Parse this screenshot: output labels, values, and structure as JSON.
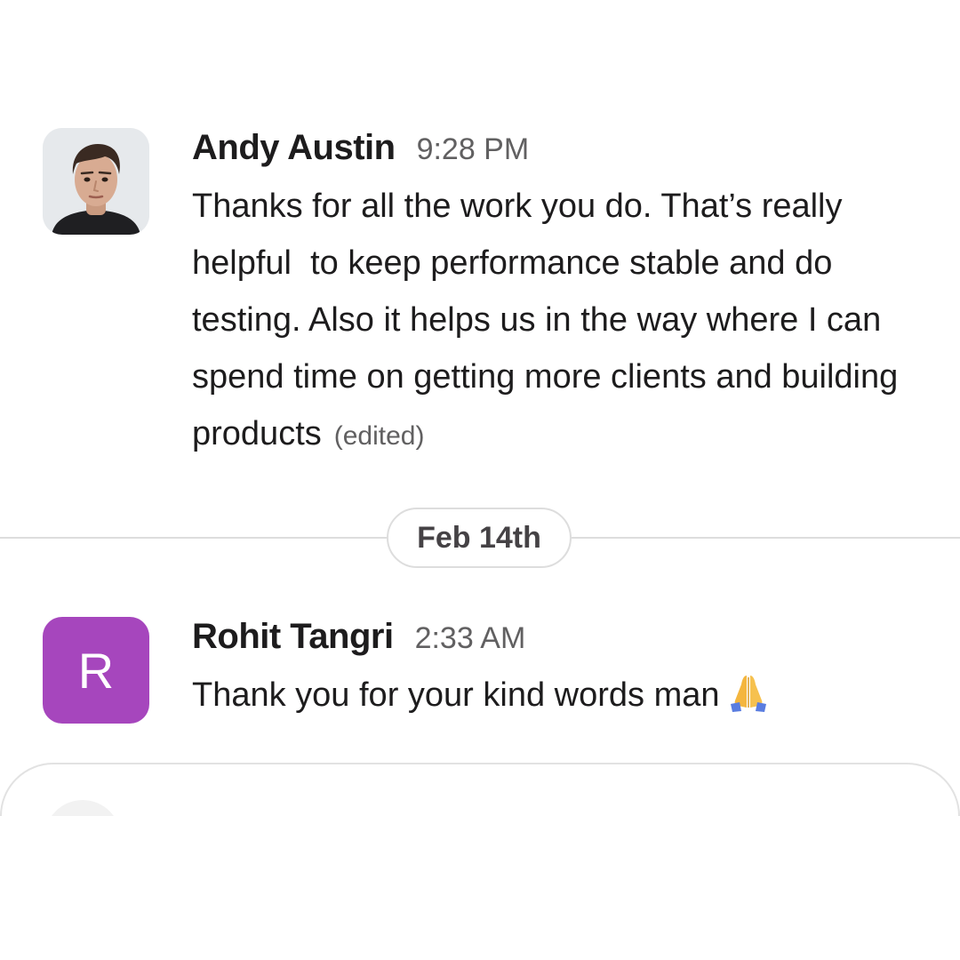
{
  "messages": [
    {
      "author": "Andy Austin",
      "time": "9:28 PM",
      "text": "Thanks for all the work you do. That’s really helpful  to keep performance stable and do testing. Also it helps us in the way where I can spend time on getting more clients and building products",
      "edited_label": "(edited)",
      "avatar": "photo"
    },
    {
      "author": "Rohit Tangri",
      "time": "2:33 AM",
      "text": "Thank you for your kind words man",
      "emoji": "folded-hands-icon",
      "avatar_letter": "R",
      "avatar_color": "#a646bd"
    }
  ],
  "date_divider": "Feb 14th",
  "colors": {
    "text": "#1d1c1d",
    "muted": "#616061",
    "divider": "#dddddd"
  }
}
